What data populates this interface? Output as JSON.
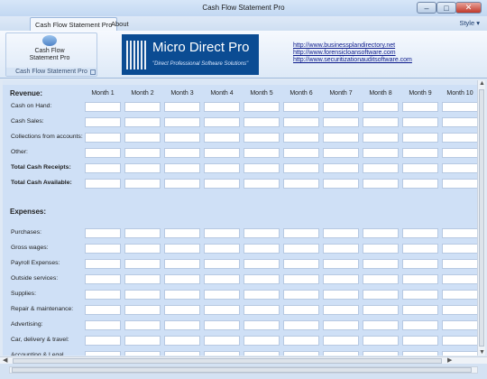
{
  "window": {
    "title": "Cash Flow Statement Pro"
  },
  "ribbon_tabs": [
    {
      "label": "Cash Flow Statement Pro",
      "active": true
    },
    {
      "label": "About",
      "active": false
    }
  ],
  "style_menu": "Style ▾",
  "ribbon": {
    "group_button": "Cash Flow\nStatement Pro",
    "group_label": "Cash Flow Statement Pro"
  },
  "logo": {
    "title": "Micro Direct Pro",
    "subtitle": "\"Direct Professional Software Solutions\""
  },
  "links": [
    "http://www.businessplandirectory.net",
    "http://www.forensicloansoftware.com",
    "http://www.securitizationauditsoftware.com"
  ],
  "months": [
    "Month 1",
    "Month 2",
    "Month 3",
    "Month 4",
    "Month 5",
    "Month 6",
    "Month 7",
    "Month 8",
    "Month 9",
    "Month 10"
  ],
  "revenue": {
    "heading": "Revenue:",
    "rows": [
      "Cash on Hand:",
      "Cash Sales:",
      "Collections from accounts:",
      "Other:",
      "Total Cash Receipts:",
      "Total Cash Available:"
    ]
  },
  "expenses": {
    "heading": "Expenses:",
    "rows": [
      "Purchases:",
      "Gross wages:",
      "Payroll Expenses:",
      "Outside services:",
      "Supplies:",
      "Repair & maintenance:",
      "Advertising:",
      "Car, delivery & travel:",
      "Accounting & Legal"
    ]
  }
}
